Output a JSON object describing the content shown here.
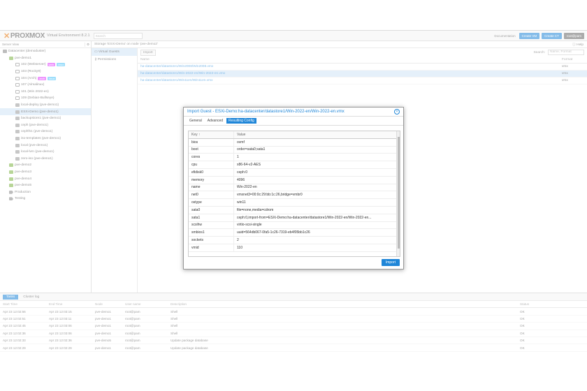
{
  "header": {
    "logo_text": "PROXMOX",
    "logo_sub": "Virtual Environment 8.2.1",
    "search_placeholder": "Search",
    "documentation": "Documentation",
    "create_vm": "Create VM",
    "create_ct": "Create CT",
    "user": "root@pam"
  },
  "left": {
    "view_label": "Server View",
    "items": [
      {
        "label": "Datacenter (demoduster)",
        "icon": "datacenter-icon",
        "indent": 0
      },
      {
        "label": "pve-demo1",
        "icon": "node-icon",
        "indent": 1
      },
      {
        "label": "102 (Webserver)",
        "icon": "vm-icon",
        "indent": 2,
        "tags": [
          [
            "web",
            "#e040fb"
          ],
          [
            "linux",
            "#4fc3f7"
          ]
        ]
      },
      {
        "label": "103 (Rocky9)",
        "icon": "vm-icon",
        "indent": 2
      },
      {
        "label": "104 (Arch)",
        "icon": "vm-icon",
        "indent": 2,
        "tags": [
          [
            "arch",
            "#e040fb"
          ],
          [
            "linux",
            "#4fc3f7"
          ]
        ]
      },
      {
        "label": "107 (Almalinux)",
        "icon": "vm-icon",
        "indent": 2
      },
      {
        "label": "101 (Win 2022-en)",
        "icon": "vm-icon",
        "indent": 2
      },
      {
        "label": "109 (Debian-Bullseye)",
        "icon": "vm-icon",
        "indent": 2
      },
      {
        "label": "local-deploy (pve-demo1)",
        "icon": "storage-icon",
        "indent": 2
      },
      {
        "label": "ESXi-Demo (pve-demo1)",
        "icon": "esxi-icon",
        "indent": 2,
        "selected": true
      },
      {
        "label": "backupstore1 (pve-demo1)",
        "icon": "storage-icon",
        "indent": 2
      },
      {
        "label": "ceph (pve-demo1)",
        "icon": "storage-icon",
        "indent": 2
      },
      {
        "label": "cephfs1 (pve-demo1)",
        "icon": "storage-icon",
        "indent": 2
      },
      {
        "label": "iso-templates (pve-demo1)",
        "icon": "storage-icon",
        "indent": 2
      },
      {
        "label": "local (pve-demo1)",
        "icon": "storage-icon",
        "indent": 2
      },
      {
        "label": "local-lvm (pve-demo1)",
        "icon": "storage-icon",
        "indent": 2
      },
      {
        "label": "zero-iso (pve-demo1)",
        "icon": "storage-icon",
        "indent": 2
      },
      {
        "label": "pve-demo2",
        "icon": "node-icon",
        "indent": 1
      },
      {
        "label": "pve-demo3",
        "icon": "node-icon",
        "indent": 1
      },
      {
        "label": "pve-demo4",
        "icon": "node-icon",
        "indent": 1
      },
      {
        "label": "pve-demo5",
        "icon": "node-icon",
        "indent": 1
      },
      {
        "label": "Production",
        "icon": "pool-icon",
        "indent": 1
      },
      {
        "label": "Testing",
        "icon": "pool-icon",
        "indent": 1
      }
    ]
  },
  "center": {
    "title": "Storage 'ESXi-Demo' on node 'pve-demo2'",
    "help": "Help",
    "nav": [
      "Virtual Guests",
      "Permissions"
    ],
    "import_btn": "Import",
    "search_label": "Search:",
    "search_placeholder": "Name, Format",
    "col_name": "Name",
    "col_format": "Format",
    "rows": [
      {
        "name": "ha-datacenter/datastore1/Win2008/Win2008.vmx",
        "format": "vmx"
      },
      {
        "name": "ha-datacenter/datastore1/Win-2022-en/Win-2022-en.vmx",
        "format": "vmx",
        "selected": true
      },
      {
        "name": "ha-datacenter/datastore1/Win11en/Win11en.vmx",
        "format": "vmx"
      }
    ]
  },
  "bottom": {
    "tabs": [
      "Tasks",
      "Cluster log"
    ],
    "headers": [
      "Start Time",
      "End Time",
      "Node",
      "User name",
      "Description",
      "Status"
    ],
    "rows": [
      [
        "Apr 23 12:02:56",
        "Apr 23 12:03:15",
        "pve-demo1",
        "root@pam",
        "Shell",
        "OK"
      ],
      [
        "Apr 23 12:02:51",
        "Apr 23 12:03:11",
        "pve-demo1",
        "root@pam",
        "Shell",
        "OK"
      ],
      [
        "Apr 23 12:02:45",
        "Apr 23 12:03:06",
        "pve-demo1",
        "root@pam",
        "Shell",
        "OK"
      ],
      [
        "Apr 23 12:02:36",
        "Apr 23 12:03:06",
        "pve-demo1",
        "root@pam",
        "Shell",
        "OK"
      ],
      [
        "Apr 23 12:02:33",
        "Apr 23 12:02:36",
        "pve-demo5",
        "root@pam",
        "Update package database",
        "OK"
      ],
      [
        "Apr 23 12:02:29",
        "Apr 23 12:02:29",
        "pve-demo1",
        "root@pam",
        "Update package database",
        "OK"
      ]
    ]
  },
  "modal": {
    "title": "Import Guest - ESXi-Demo:ha-datacenter/datastore1/Win-2022-en/Win-2022-en.vmx",
    "tabs": [
      "General",
      "Advanced",
      "Resulting Config"
    ],
    "active_tab": 2,
    "col_key": "Key ↑",
    "col_value": "Value",
    "rows": [
      [
        "bios",
        "ovmf"
      ],
      [
        "boot",
        "order=sata0;sata1"
      ],
      [
        "cores",
        "1"
      ],
      [
        "cpu",
        "x86-64-v2-AES"
      ],
      [
        "efidisk0",
        "ceph:0"
      ],
      [
        "memory",
        "4096"
      ],
      [
        "name",
        "Win-2022-en"
      ],
      [
        "net0",
        "vmxnet3=00:0c:29:bb:1c:26,bridge=vmbr0"
      ],
      [
        "ostype",
        "win11"
      ],
      [
        "sata0",
        "file=none,media=cdrom"
      ],
      [
        "sata1",
        "ceph:0,import-from=ESXi-Demo:ha-datacenter/datastore1/Win-2022-en/Win-2022-en..."
      ],
      [
        "scsihw",
        "virtio-scsi-single"
      ],
      [
        "smbios1",
        "uuid=564db067-0fa5-1c26-7319-eb4f05bb1c26"
      ],
      [
        "sockets",
        "2"
      ],
      [
        "vmid",
        "110"
      ]
    ],
    "import_btn": "Import"
  },
  "colors": {
    "accent": "#1f86d8",
    "logo_x": "#e57000"
  }
}
